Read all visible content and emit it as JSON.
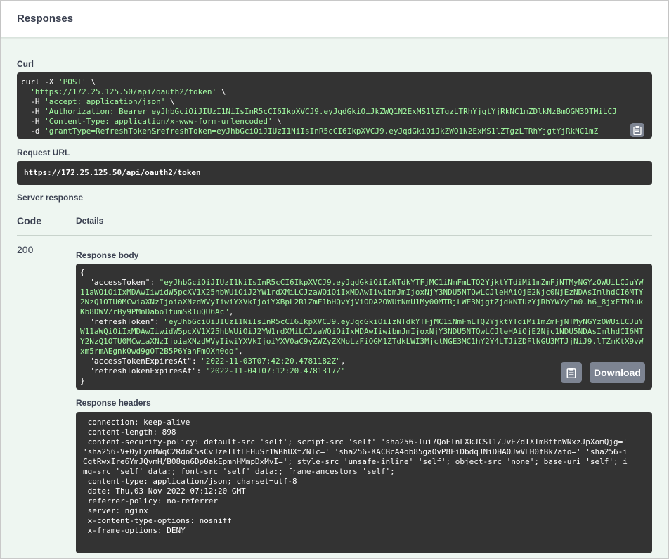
{
  "section_title": "Responses",
  "curl": {
    "label": "Curl",
    "lines": [
      {
        "pre": "curl -X ",
        "str": "'POST'",
        "post": " \\"
      },
      {
        "pre": "  ",
        "str": "'https://172.25.125.50/api/oauth2/token'",
        "post": " \\"
      },
      {
        "pre": "  -H ",
        "str": "'accept: application/json'",
        "post": " \\"
      },
      {
        "pre": "  -H ",
        "str": "'Authorization: Bearer eyJhbGciOiJIUzI1NiIsInR5cCI6IkpXVCJ9.eyJqdGkiOiJkZWQ1N2ExMS1lZTgzLTRhYjgtYjRkNC1mZDlkNzBmOGM3OTMiLCJ",
        "post": ""
      },
      {
        "pre": "  -H ",
        "str": "'Content-Type: application/x-www-form-urlencoded'",
        "post": " \\"
      },
      {
        "pre": "  -d ",
        "str": "'grantType=RefreshToken&refreshToken=eyJhbGciOiJIUzI1NiIsInR5cCI6IkpXVCJ9.eyJqdGkiOiJkZWQ1N2ExMS1lZTgzLTRhYjgtYjRkNC1mZ",
        "post": ""
      }
    ]
  },
  "request_url": {
    "label": "Request URL",
    "value": "https://172.25.125.50/api/oauth2/token"
  },
  "server_response": {
    "label": "Server response",
    "col_code": "Code",
    "col_details": "Details",
    "code": "200",
    "body_label": "Response body",
    "headers_label": "Response headers",
    "download_label": "Download",
    "body": {
      "open": "{",
      "close": "}",
      "access_token_key": "  \"accessToken\": ",
      "access_token": "\"eyJhbGciOiJIUzI1NiIsInR5cCI6IkpXVCJ9.eyJqdGkiOiIzNTdkYTFjMC1iNmFmLTQ2YjktYTdiMi1mZmFjNTMyNGYzOWUiLCJuYW11aWQiOiIxMDAwIiwidW5pcXV1X25hbWUiOiJ2YW1rdXMiLCJzaWQiOiIxMDAwIiwibmJmIjoxNjY3NDU5NTQwLCJleHAiOjE2Njc0NjEzNDAsImlhdCI6MTY2NzQ1OTU0MCwiaXNzIjoiaXNzdWVyIiwiYXVkIjoiYXBpL2RlZmF1bHQvYjViODA2OWUtNmU1My00MTRjLWE3NjgtZjdkNTUzYjRhYWYyIn0.h6_8jxETN9ukKb8DWVZrBy9PMnDabo1tumSR1uQU6Ac\"",
      "refresh_token_key": "  \"refreshToken\": ",
      "refresh_token": "\"eyJhbGciOiJIUzI1NiIsInR5cCI6IkpXVCJ9.eyJqdGkiOiIzNTdkYTFjMC1iNmFmLTQ2YjktYTdiMi1mZmFjNTMyNGYzOWUiLCJuYW11aWQiOiIxMDAwIiwidW5pcXV1X25hbWUiOiJ2YW1rdXMiLCJzaWQiOiIxMDAwIiwibmJmIjoxNjY3NDU5NTQwLCJleHAiOjE2Njc1NDU5NDAsImlhdCI6MTY2NzQ1OTU0MCwiaXNzIjoiaXNzdWVyIiwiYXVkIjoiYXV0aC9yZWZyZXNoLzFiOGM1ZTdkLWI3MjctNGE3MC1hY2Y4LTJiZDFlNGU3MTJjNiJ9.lTZmKtX9vWxm5rmAEgnk0wd9gOT2B5P6YanFmOXh0qo\"",
      "access_exp_key": "  \"accessTokenExpiresAt\": ",
      "access_exp": "\"2022-11-03T07:42:20.4781182Z\"",
      "refresh_exp_key": "  \"refreshTokenExpiresAt\": ",
      "refresh_exp": "\"2022-11-04T07:12:20.4781317Z\""
    },
    "headers_text": " connection: keep-alive \n content-length: 898 \n content-security-policy: default-src 'self'; script-src 'self' 'sha256-Tui7QoFlnLXkJCSl1/JvEZdIXTmBttnWNxzJpXomQjg=' 'sha256-V+0yLynBWqC2RdoC5sCvJzeIltLEHuSr1WBhUXtZNIc=' 'sha256-KACBcA4ob85gaOvP8FiDbdqJNiDHA0JwVLH0fBk7ato=' 'sha256-iCgtRwxIre6YmJQvmH/B08qn6Dp0akEpmnHMmpDxMvI='; style-src 'unsafe-inline' 'self'; object-src 'none'; base-uri 'self'; img-src 'self' data:; font-src 'self' data:; frame-ancestors 'self'; \n content-type: application/json; charset=utf-8 \n date: Thu,03 Nov 2022 07:12:20 GMT \n referrer-policy: no-referrer \n server: nginx \n x-content-type-options: nosniff \n x-frame-options: DENY "
  },
  "icons": {
    "copy": "clipboard-icon"
  }
}
